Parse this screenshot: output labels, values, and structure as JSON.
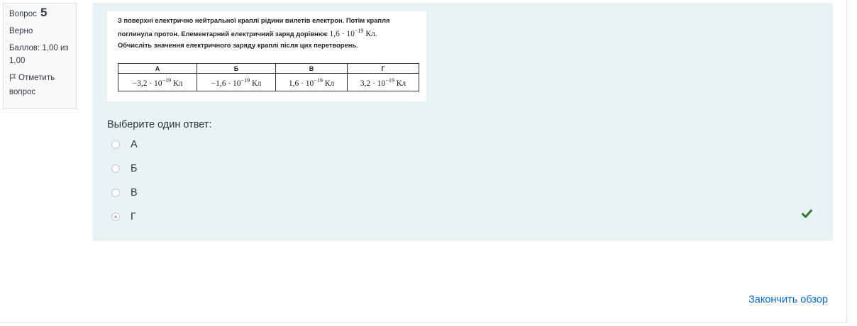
{
  "question_info": {
    "label": "Вопрос",
    "number": "5",
    "state": "Верно",
    "grade_line1": "Баллов: 1,00 из",
    "grade_line2": "1,00",
    "flag_line1": "Отметить",
    "flag_line2": "вопрос"
  },
  "question_image": {
    "text_line1": "З поверхні електрично нейтральної краплі рідини вилетів електрон. Потім крапля",
    "text_line2_prefix": "поглинула протон. Елементарний електричний заряд дорівнює",
    "charge_mantissa": "1,6 · 10",
    "charge_exponent": "−19",
    "charge_unit": "Кл.",
    "text_line3": "Обчисліть значення електричного заряду краплі після цих перетворень.",
    "table": {
      "headers": [
        "А",
        "Б",
        "В",
        "Г"
      ],
      "cells": [
        {
          "mantissa": "−3,2 · 10",
          "exponent": "−19",
          "unit": "Кл"
        },
        {
          "mantissa": "−1,6 · 10",
          "exponent": "−19",
          "unit": "Кл"
        },
        {
          "mantissa": "1,6 · 10",
          "exponent": "−19",
          "unit": "Кл"
        },
        {
          "mantissa": "3,2 · 10",
          "exponent": "−19",
          "unit": "Кл"
        }
      ]
    }
  },
  "prompt": "Выберите один ответ:",
  "answers": [
    {
      "label": "А",
      "checked": false
    },
    {
      "label": "Б",
      "checked": false
    },
    {
      "label": "В",
      "checked": false
    },
    {
      "label": "Г",
      "checked": true
    }
  ],
  "finish_link": "Закончить обзор",
  "colors": {
    "accent": "#0f6cbf",
    "correct": "#357a32",
    "content_bg": "#e7f3f5"
  }
}
